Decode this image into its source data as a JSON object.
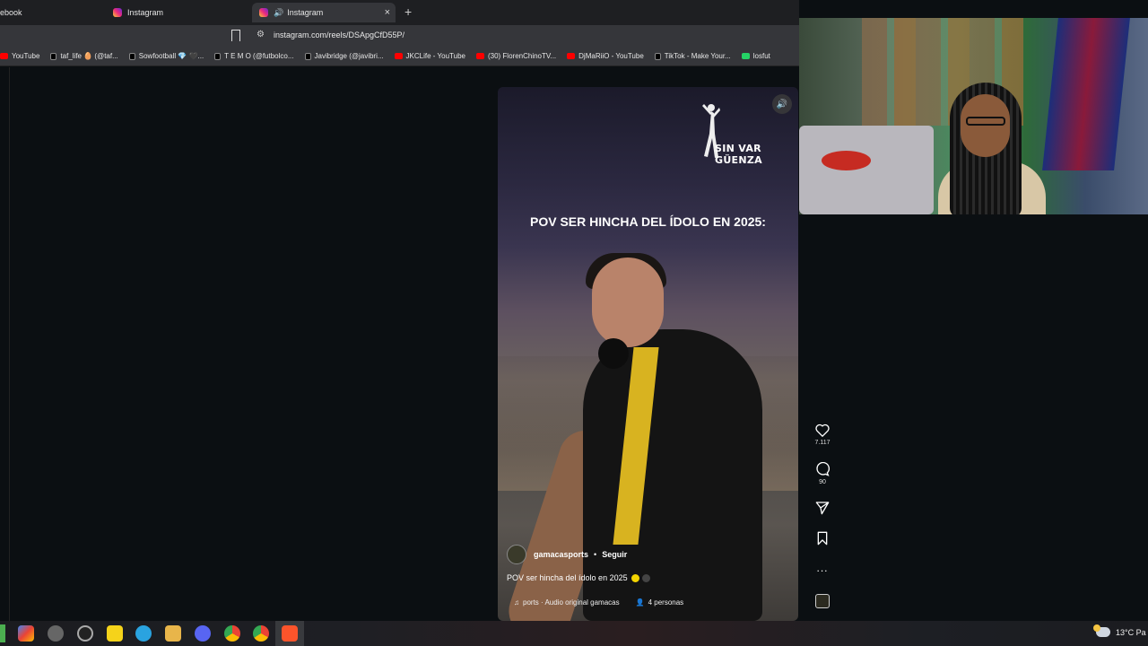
{
  "browser": {
    "tabs": [
      {
        "label": "ebook"
      },
      {
        "label": "Instagram"
      },
      {
        "label": "Instagram",
        "active": true
      }
    ],
    "url": "instagram.com/reels/DSApgCfD55P/",
    "bookmarks": [
      {
        "label": "YouTube",
        "icon": "youtube"
      },
      {
        "label": "taf_life 🥚 (@taf...",
        "icon": "tiktok"
      },
      {
        "label": "Sowfootball 💎 🖤...",
        "icon": "tiktok"
      },
      {
        "label": "T E M O (@futbolco...",
        "icon": "tiktok"
      },
      {
        "label": "Javibridge (@javibri...",
        "icon": "tiktok"
      },
      {
        "label": "JKCLife - YouTube",
        "icon": "youtube"
      },
      {
        "label": "(30) FlorenChinoTV...",
        "icon": "youtube"
      },
      {
        "label": "DjMaRiiO - YouTube",
        "icon": "youtube"
      },
      {
        "label": "TikTok - Make Your...",
        "icon": "tiktok"
      },
      {
        "label": "losfut",
        "icon": "kick"
      }
    ]
  },
  "reel": {
    "logo_text": "SIN VAR GÜENZA",
    "overlay_caption": "POV SER HINCHA DEL ÍDOLO EN 2025:",
    "author": "gamacasports",
    "separator": "•",
    "follow_label": "Seguir",
    "description": "POV ser hincha del ídolo en 2025",
    "audio": "ports · Audio original  gamacas",
    "people": "4 personas"
  },
  "actions": {
    "likes": "7.117",
    "comments": "90",
    "more": "..."
  },
  "taskbar": {
    "weather": "13°C  Pa"
  },
  "colors": {
    "page_bg": "#0b0f12",
    "chrome_tab_bg": "#1e1f22",
    "chrome_bar_bg": "#35363a",
    "accent_yellow": "#f3d400"
  }
}
